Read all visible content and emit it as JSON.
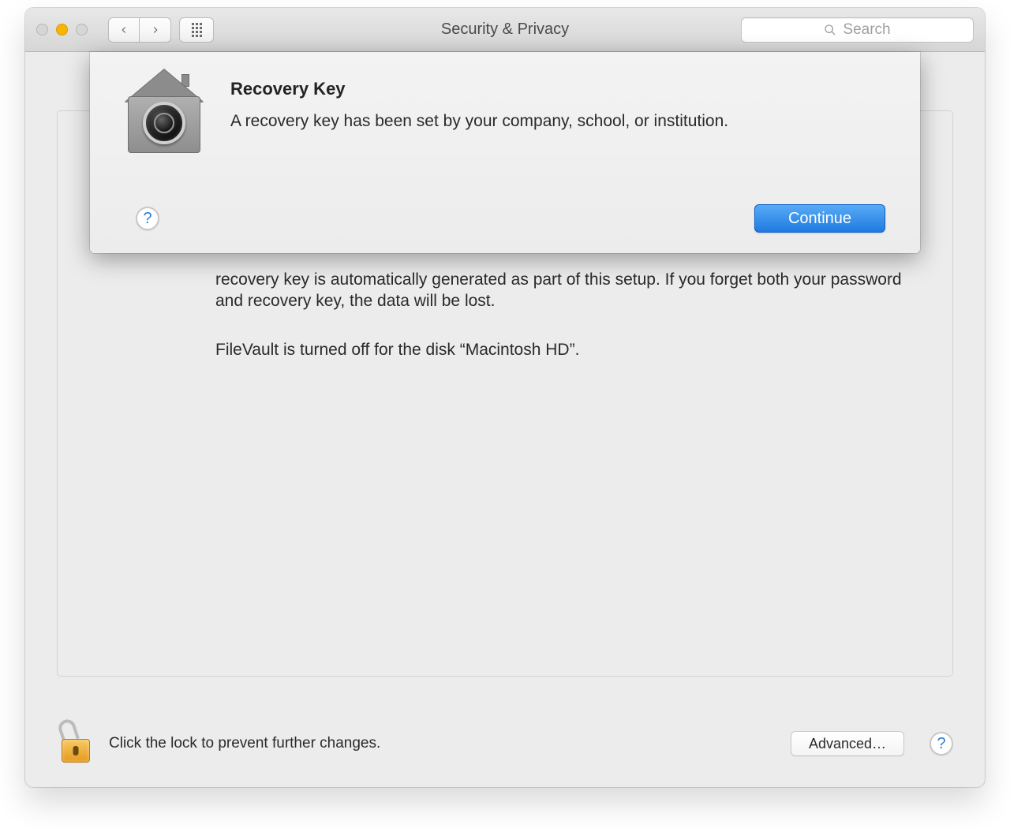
{
  "titlebar": {
    "title": "Security & Privacy",
    "search_placeholder": "Search"
  },
  "body": {
    "paragraph1": "recovery key is automatically generated as part of this setup. If you forget both your password and recovery key, the data will be lost.",
    "paragraph2": "FileVault is turned off for the disk “Macintosh HD”."
  },
  "footer": {
    "lock_text": "Click the lock to prevent further changes.",
    "advanced_label": "Advanced…"
  },
  "dialog": {
    "heading": "Recovery Key",
    "message": "A recovery key has been set by your company, school, or institution.",
    "continue_label": "Continue"
  }
}
